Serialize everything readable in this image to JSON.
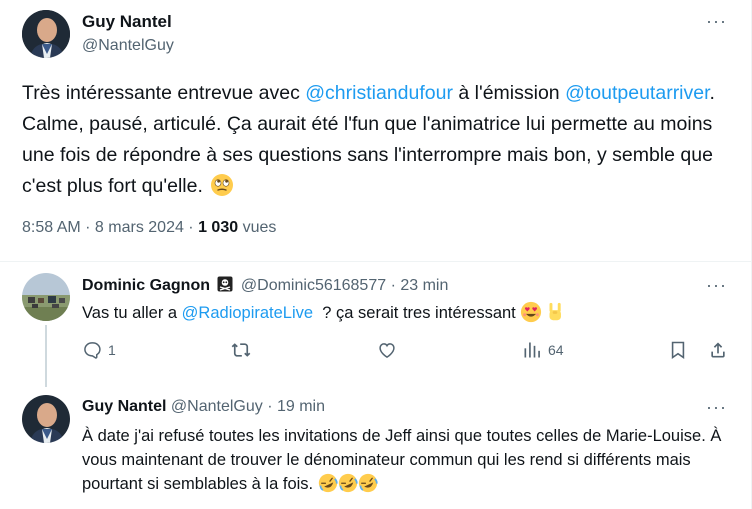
{
  "main": {
    "author_name": "Guy Nantel",
    "author_handle": "@NantelGuy",
    "text_1": "Très intéressante entrevue avec ",
    "mention_1": "@christiandufour",
    "text_2": " à l'émission ",
    "mention_2": "@toutpeutarriver",
    "text_3": ". Calme, pausé, articulé. Ça aurait été l'fun que l'animatrice lui permette au moins une fois de répondre à ses questions sans l'interrompre mais bon, y semble que c'est plus fort qu'elle. ",
    "time": "8:58 AM",
    "sep1": " · ",
    "date": "8 mars 2024",
    "sep2": " · ",
    "views_count": "1 030",
    "views_label": " vues",
    "more_label": "···"
  },
  "reply1": {
    "name": "Dominic Gagnon",
    "handle": "@Dominic56168577",
    "time_sep": " · ",
    "time": "23 min",
    "text_1": "Vas tu aller a ",
    "mention": "@RadiopirateLive",
    "text_2": "  ? ça serait tres intéressant ",
    "more_label": "···",
    "replies": "1",
    "retweets": "",
    "likes": "",
    "views": "64"
  },
  "reply2": {
    "name": "Guy Nantel",
    "handle": "@NantelGuy",
    "time_sep": " · ",
    "time": "19 min",
    "text": "À date j'ai refusé toutes les invitations de Jeff ainsi que toutes celles de Marie-Louise. À vous maintenant de trouver le dénominateur commun qui les rend si différents mais pourtant si semblables à la fois. ",
    "more_label": "···"
  },
  "icons": {
    "main_end_emoji": "face-with-rolling-eyes-icon",
    "reply1_emojis": [
      "smiling-face-with-heart-eyes-icon",
      "sign-of-horns-icon"
    ],
    "reply2_emojis": [
      "rolling-on-floor-laughing-icon",
      "rolling-on-floor-laughing-icon",
      "rolling-on-floor-laughing-icon"
    ],
    "badge": "pirate-flag-icon"
  },
  "colors": {
    "link": "#1d9bf0",
    "secondary": "#536471",
    "text": "#0f1419"
  }
}
